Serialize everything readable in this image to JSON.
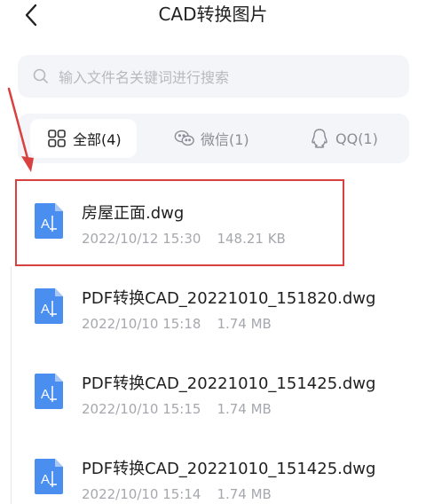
{
  "header": {
    "title": "CAD转换图片"
  },
  "search": {
    "placeholder": "输入文件名关键词进行搜索"
  },
  "tabs": [
    {
      "label": "全部(4)",
      "icon": "grid-icon",
      "active": true
    },
    {
      "label": "微信(1)",
      "icon": "wechat-icon",
      "active": false
    },
    {
      "label": "QQ(1)",
      "icon": "qq-icon",
      "active": false
    }
  ],
  "files": [
    {
      "name": "房屋正面.dwg",
      "date": "2022/10/12 15:30",
      "size": "148.21 KB",
      "highlighted": true
    },
    {
      "name": "PDF转换CAD_20221010_151820.dwg",
      "date": "2022/10/10 15:18",
      "size": "1.74 MB"
    },
    {
      "name": "PDF转换CAD_20221010_151425.dwg",
      "date": "2022/10/10 15:15",
      "size": "1.74 MB"
    },
    {
      "name": "PDF转换CAD_20221010_151425.dwg",
      "date": "2022/10/10 15:14",
      "size": "1.74 MB"
    }
  ],
  "colors": {
    "accent": "#4a8ef0",
    "annotation": "#d94141",
    "panel": "#f4f5f8"
  }
}
